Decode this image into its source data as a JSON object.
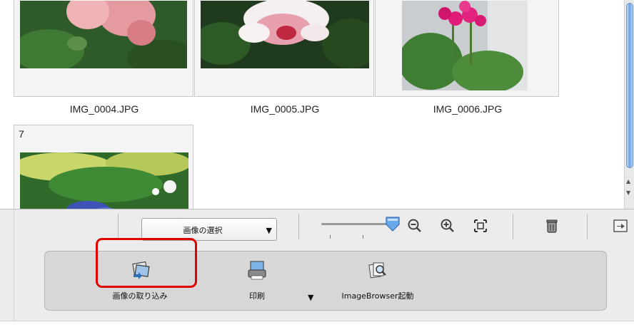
{
  "grid": {
    "cells": [
      {
        "filename": "IMG_0004.JPG"
      },
      {
        "filename": "IMG_0005.JPG"
      },
      {
        "filename": "IMG_0006.JPG"
      },
      {
        "number": "7"
      }
    ]
  },
  "toolbar": {
    "select_label": "画像の選択",
    "zoom_slider": {
      "level_fraction": 0.95,
      "ticks": 2
    }
  },
  "panel": {
    "import_label": "画像の取り込み",
    "print_label": "印刷",
    "browser_label": "ImageBrowser起動"
  },
  "colors": {
    "highlight": "#e00000",
    "scroll_accent": "#6aa4e6",
    "panel_bg": "#d7d7d7"
  },
  "icons": [
    "zoom-out-icon",
    "zoom-in-icon",
    "fit-icon",
    "trash-icon",
    "export-icon",
    "import-icon",
    "print-icon",
    "image-browser-icon"
  ]
}
